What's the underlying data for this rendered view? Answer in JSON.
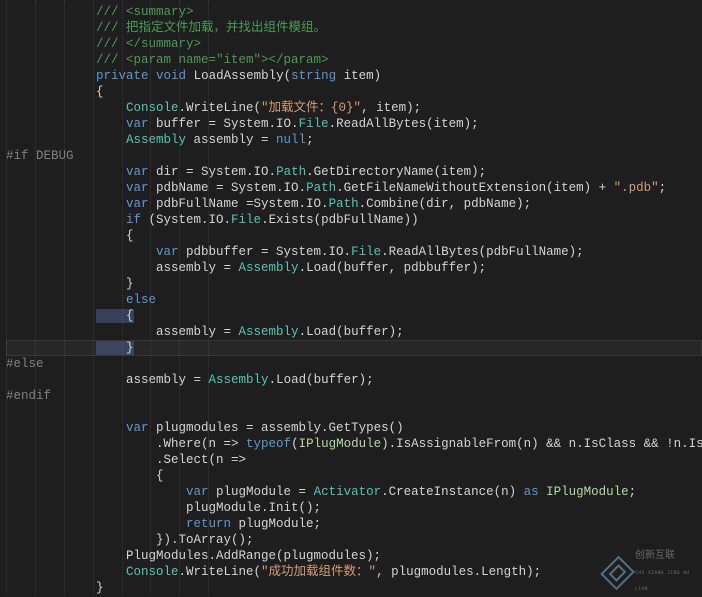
{
  "lines": [
    [
      [
        "cmt",
        "/// <summary>"
      ]
    ],
    [
      [
        "cmt",
        "/// 把指定文件加载，并找出组件模组。"
      ]
    ],
    [
      [
        "cmt",
        "/// </summary>"
      ]
    ],
    [
      [
        "cmt",
        "/// <param name=\"item\"></param>"
      ]
    ],
    [
      [
        "kw",
        "private"
      ],
      [
        "punc",
        " "
      ],
      [
        "kw",
        "void"
      ],
      [
        "punc",
        " "
      ],
      [
        "id",
        "LoadAssembly("
      ],
      [
        "kw",
        "string"
      ],
      [
        "punc",
        " item)"
      ]
    ],
    [
      [
        "punc",
        "{"
      ]
    ],
    [
      [
        "cls",
        "    Console"
      ],
      [
        "punc",
        ".WriteLine("
      ],
      [
        "str",
        "\"加载文件：{0}\""
      ],
      [
        "punc",
        ", item);"
      ]
    ],
    [
      [
        "kw",
        "    var"
      ],
      [
        "punc",
        " buffer = System.IO."
      ],
      [
        "cls",
        "File"
      ],
      [
        "punc",
        ".ReadAllBytes(item);"
      ]
    ],
    [
      [
        "cls",
        "    Assembly"
      ],
      [
        "punc",
        " assembly = "
      ],
      [
        "kw",
        "null"
      ],
      [
        "punc",
        ";"
      ]
    ],
    [
      [
        "pp",
        "#if DEBUG"
      ]
    ],
    [
      [
        "kw",
        "    var"
      ],
      [
        "punc",
        " dir = System.IO."
      ],
      [
        "cls",
        "Path"
      ],
      [
        "punc",
        ".GetDirectoryName(item);"
      ]
    ],
    [
      [
        "kw",
        "    var"
      ],
      [
        "punc",
        " pdbName = System.IO."
      ],
      [
        "cls",
        "Path"
      ],
      [
        "punc",
        ".GetFileNameWithoutExtension(item) + "
      ],
      [
        "str",
        "\".pdb\""
      ],
      [
        "punc",
        ";"
      ]
    ],
    [
      [
        "kw",
        "    var"
      ],
      [
        "punc",
        " pdbFullName =System.IO."
      ],
      [
        "cls",
        "Path"
      ],
      [
        "punc",
        ".Combine(dir, pdbName);"
      ]
    ],
    [
      [
        "kw",
        "    if"
      ],
      [
        "punc",
        " (System.IO."
      ],
      [
        "cls",
        "File"
      ],
      [
        "punc",
        ".Exists(pdbFullName))"
      ]
    ],
    [
      [
        "punc",
        "    {"
      ]
    ],
    [
      [
        "kw",
        "        var"
      ],
      [
        "punc",
        " pdbbuffer = System.IO."
      ],
      [
        "cls",
        "File"
      ],
      [
        "punc",
        ".ReadAllBytes(pdbFullName);"
      ]
    ],
    [
      [
        "punc",
        "        assembly = "
      ],
      [
        "cls",
        "Assembly"
      ],
      [
        "punc",
        ".Load(buffer, pdbbuffer);"
      ]
    ],
    [
      [
        "punc",
        "    }"
      ]
    ],
    [
      [
        "kw",
        "    else"
      ]
    ],
    [
      [
        "punc",
        "    {"
      ]
    ],
    [
      [
        "punc",
        "        assembly = "
      ],
      [
        "cls",
        "Assembly"
      ],
      [
        "punc",
        ".Load(buffer);"
      ]
    ],
    [
      [
        "punc",
        "    }"
      ]
    ],
    [
      [
        "pp",
        "#else"
      ]
    ],
    [
      [
        "punc",
        "    assembly = "
      ],
      [
        "cls",
        "Assembly"
      ],
      [
        "punc",
        ".Load(buffer);"
      ]
    ],
    [
      [
        "pp",
        "#endif"
      ]
    ],
    [
      [
        "punc",
        ""
      ]
    ],
    [
      [
        "kw",
        "    var"
      ],
      [
        "punc",
        " plugmodules = assembly.GetTypes()"
      ]
    ],
    [
      [
        "punc",
        "        .Where(n => "
      ],
      [
        "kw",
        "typeof"
      ],
      [
        "punc",
        "("
      ],
      [
        "intf",
        "IPlugModule"
      ],
      [
        "punc",
        ").IsAssignableFrom(n) && n.IsClass && !n.IsAbstract)"
      ]
    ],
    [
      [
        "punc",
        "        .Select(n =>"
      ]
    ],
    [
      [
        "punc",
        "        {"
      ]
    ],
    [
      [
        "kw",
        "            var"
      ],
      [
        "punc",
        " plugModule = "
      ],
      [
        "cls",
        "Activator"
      ],
      [
        "punc",
        ".CreateInstance(n) "
      ],
      [
        "kw",
        "as"
      ],
      [
        "punc",
        " "
      ],
      [
        "intf",
        "IPlugModule"
      ],
      [
        "punc",
        ";"
      ]
    ],
    [
      [
        "punc",
        "            plugModule.Init();"
      ]
    ],
    [
      [
        "kw",
        "            return"
      ],
      [
        "punc",
        " plugModule;"
      ]
    ],
    [
      [
        "punc",
        "        }).ToArray();"
      ]
    ],
    [
      [
        "punc",
        "    PlugModules.AddRange(plugmodules);"
      ]
    ],
    [
      [
        "cls",
        "    Console"
      ],
      [
        "punc",
        ".WriteLine("
      ],
      [
        "str",
        "\"成功加载组件数：\""
      ],
      [
        "punc",
        ", plugmodules.Length);"
      ]
    ],
    [
      [
        "punc",
        "}"
      ]
    ]
  ],
  "base_indents": [
    3,
    3,
    3,
    3,
    3,
    3,
    3,
    3,
    3,
    0,
    3,
    3,
    3,
    3,
    3,
    3,
    3,
    3,
    3,
    3,
    3,
    3,
    0,
    3,
    0,
    3,
    3,
    3,
    3,
    3,
    3,
    3,
    3,
    3,
    3,
    3,
    3
  ],
  "highlight_line": 21,
  "selection_lines": [
    19,
    21
  ],
  "watermark": "创新互联",
  "watermark_sub": "CHI XIANG JING HU LIAN"
}
